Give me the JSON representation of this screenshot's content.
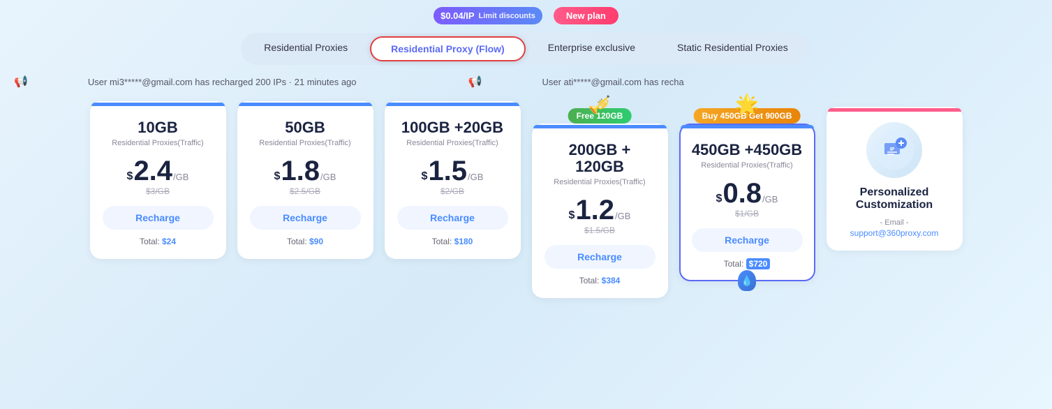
{
  "badges": {
    "price_label": "$0.04/IP",
    "limit_text": "Limit discounts",
    "new_plan": "New plan"
  },
  "tabs": [
    {
      "id": "residential",
      "label": "Residential Proxies",
      "active": false
    },
    {
      "id": "flow",
      "label": "Residential Proxy (Flow)",
      "active": true
    },
    {
      "id": "enterprise",
      "label": "Enterprise exclusive",
      "active": false
    },
    {
      "id": "static",
      "label": "Static Residential Proxies",
      "active": false
    }
  ],
  "marquee": {
    "message1": "User mi3*****@gmail.com has recharged 200 IPs · 21 minutes ago",
    "message2": "User ati*****@gmail.com has recha"
  },
  "cards": [
    {
      "id": "plan-10gb",
      "gb": "10GB",
      "type": "Residential Proxies(Traffic)",
      "price": "2.4",
      "unit": "/GB",
      "original": "$3/GB",
      "recharge": "Recharge",
      "total_label": "Total:",
      "total_val": "$24",
      "bar_color": "blue",
      "promo_badge": null,
      "promo_icon": null
    },
    {
      "id": "plan-50gb",
      "gb": "50GB",
      "type": "Residential Proxies(Traffic)",
      "price": "1.8",
      "unit": "/GB",
      "original": "$2.5/GB",
      "recharge": "Recharge",
      "total_label": "Total:",
      "total_val": "$90",
      "bar_color": "blue",
      "promo_badge": null,
      "promo_icon": null
    },
    {
      "id": "plan-100gb",
      "gb": "100GB +20GB",
      "type": "Residential Proxies(Traffic)",
      "price": "1.5",
      "unit": "/GB",
      "original": "$2/GB",
      "recharge": "Recharge",
      "total_label": "Total:",
      "total_val": "$180",
      "bar_color": "blue",
      "promo_badge": null,
      "promo_icon": null
    },
    {
      "id": "plan-200gb",
      "gb": "200GB + 120GB",
      "type": "Residential Proxies(Traffic)",
      "price": "1.2",
      "unit": "/GB",
      "original": "$1.5/GB",
      "recharge": "Recharge",
      "total_label": "Total:",
      "total_val": "$384",
      "bar_color": "blue",
      "promo_badge": "Free 120GB",
      "promo_badge_color": "green",
      "promo_icon": "🎺"
    },
    {
      "id": "plan-450gb",
      "gb": "450GB +450GB",
      "type": "Residential Proxies(Traffic)",
      "price": "0.8",
      "unit": "/GB",
      "original": "$1/GB",
      "recharge": "Recharge",
      "total_label": "Total:",
      "total_val": "$720",
      "total_highlighted": true,
      "bar_color": "blue",
      "highlighted": true,
      "promo_badge": "Buy 450GB Get 900GB",
      "promo_badge_color": "gold",
      "promo_icon": "🌟"
    }
  ],
  "custom_card": {
    "title": "Personalized\nCustomization",
    "email_label": "- Email -",
    "email": "support@360proxy.com",
    "bar_color": "pink"
  }
}
